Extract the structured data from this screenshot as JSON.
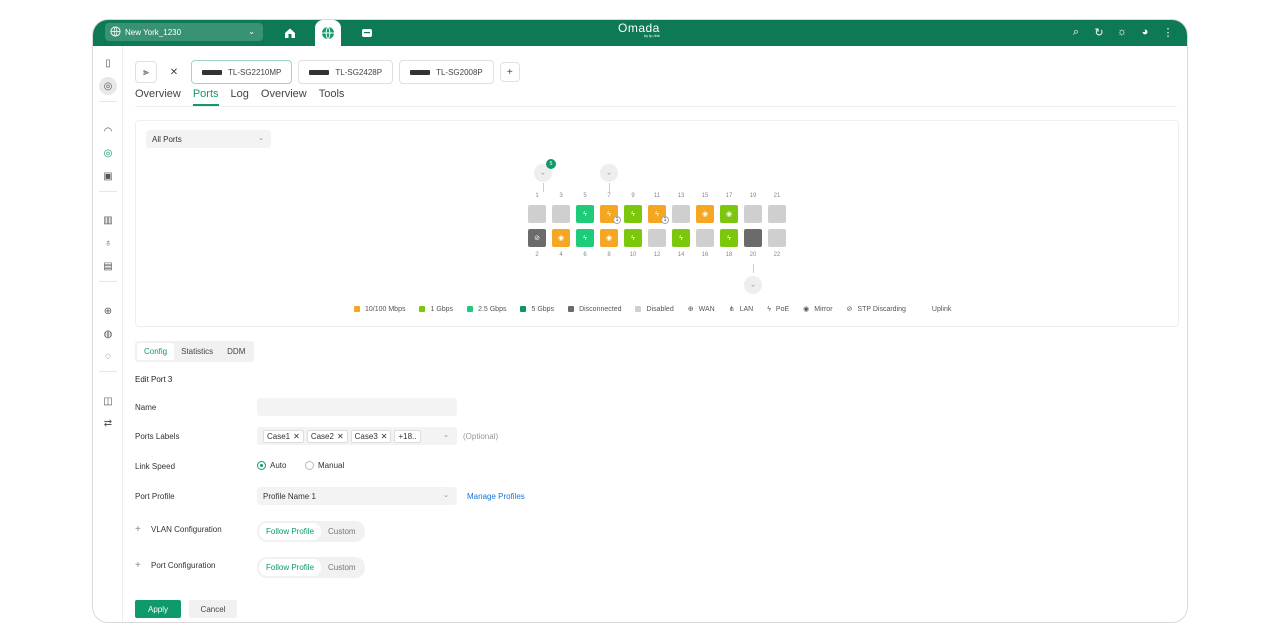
{
  "topbar": {
    "site": "New York_1230",
    "logo": "Omada",
    "logo_sub": "by tp-link"
  },
  "device_tabs": [
    "TL-SG2210MP",
    "TL-SG2428P",
    "TL-SG2008P"
  ],
  "sub_tabs": [
    "Overview",
    "Ports",
    "Log",
    "Overview",
    "Tools"
  ],
  "port_filter": "All Ports",
  "port_badges": {
    "uplink_count": "5",
    "poe_count": "1"
  },
  "ports_top": [
    "1",
    "3",
    "5",
    "7",
    "9",
    "11",
    "13",
    "15",
    "17",
    "19",
    "21"
  ],
  "ports_bottom": [
    "2",
    "4",
    "6",
    "8",
    "10",
    "12",
    "14",
    "16",
    "18",
    "20",
    "22"
  ],
  "legend": [
    "10/100 Mbps",
    "1 Gbps",
    "2.5 Gbps",
    "5 Gbps",
    "Disconnected",
    "Disabled",
    "WAN",
    "LAN",
    "PoE",
    "Mirror",
    "STP Discarding",
    "Uplink"
  ],
  "colors": {
    "brand": "#0e7a55",
    "orange": "#f5a623",
    "lime": "#7ac70c",
    "green": "#1ecb78",
    "teal": "#0b9a5d",
    "dark": "#6b6b6b",
    "disabled": "#cfcfcf"
  },
  "config_tabs": [
    "Config",
    "Statistics",
    "DDM"
  ],
  "form": {
    "title": "Edit Port 3",
    "name_label": "Name",
    "labels_label": "Ports Labels",
    "chips": [
      "Case1",
      "Case2",
      "Case3"
    ],
    "more": "+18..",
    "optional": "(Optional)",
    "link_speed_label": "Link Speed",
    "auto": "Auto",
    "manual": "Manual",
    "profile_label": "Port Profile",
    "profile_value": "Profile Name 1",
    "manage": "Manage Profiles",
    "vlan_label": "VLAN Configuration",
    "portcfg_label": "Port Configuration",
    "follow": "Follow Profile",
    "custom": "Custom",
    "apply": "Apply",
    "cancel": "Cancel"
  }
}
